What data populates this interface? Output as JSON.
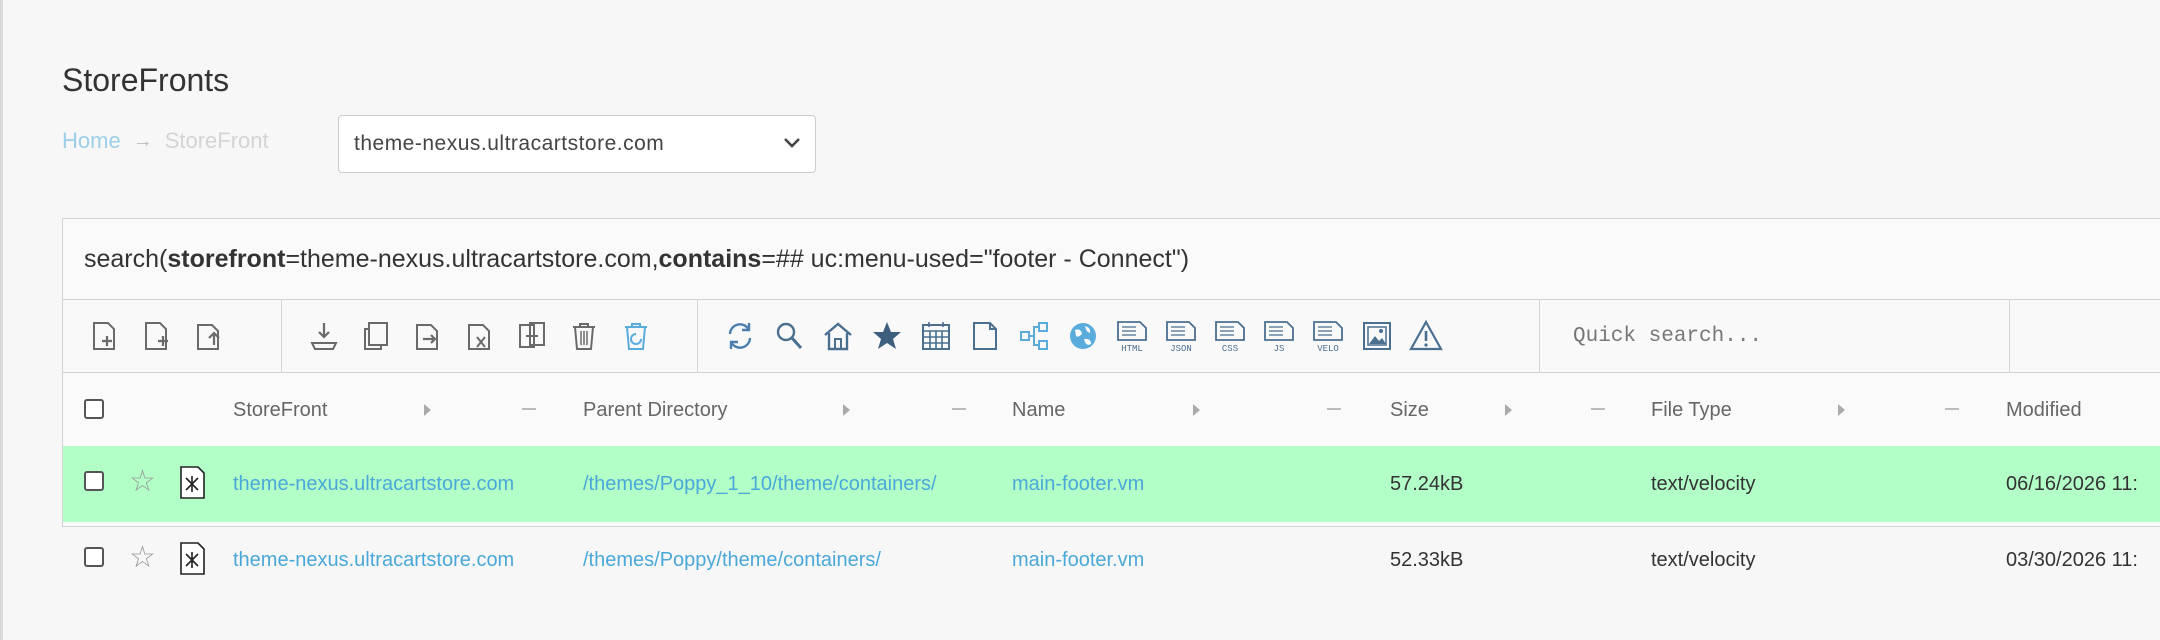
{
  "page": {
    "title": "StoreFronts"
  },
  "breadcrumb": {
    "home": "Home",
    "separator": "→",
    "current": "StoreFront"
  },
  "storefront_select": {
    "value": "theme-nexus.ultracartstore.com"
  },
  "search": {
    "prefix": "search(",
    "param1_key": "storefront",
    "param1_value": "=theme-nexus.ultracartstore.com, ",
    "param2_key": "contains",
    "param2_value": "=## uc:menu-used=\"footer - Connect\")"
  },
  "toolbar": {
    "group1": [
      "new-file-icon",
      "new-folder-icon",
      "upload-icon"
    ],
    "group2": [
      "download-icon",
      "copy-icon",
      "move-icon",
      "rename-icon",
      "compare-icon",
      "delete-icon",
      "restore-icon"
    ],
    "group3": [
      "refresh-icon",
      "search-icon",
      "home-icon",
      "favorite-icon",
      "calendar-icon",
      "folder-icon",
      "hierarchy-icon",
      "globe-icon",
      "html-icon",
      "json-icon",
      "css-icon",
      "js-icon",
      "velo-icon",
      "image-icon",
      "warning-icon"
    ],
    "file_type_labels": {
      "html": "HTML",
      "json": "JSON",
      "css": "CSS",
      "js": "JS",
      "velo": "VELO"
    },
    "quick_search_placeholder": "Quick search..."
  },
  "columns": [
    "StoreFront",
    "Parent Directory",
    "Name",
    "Size",
    "File Type",
    "Modified"
  ],
  "rows": [
    {
      "storefront": "theme-nexus.ultracartstore.com",
      "parent_directory": "/themes/Poppy_1_10/theme/containers/",
      "name": "main-footer.vm",
      "size": "57.24kB",
      "file_type": "text/velocity",
      "modified": "06/16/2026 11:",
      "highlighted": true
    },
    {
      "storefront": "theme-nexus.ultracartstore.com",
      "parent_directory": "/themes/Poppy/theme/containers/",
      "name": "main-footer.vm",
      "size": "52.33kB",
      "file_type": "text/velocity",
      "modified": "03/30/2026 11:",
      "highlighted": false
    }
  ],
  "colors": {
    "link": "#4aa8d8",
    "highlight_row": "#b3ffc8",
    "icon": "#4a6f8f",
    "icon_accent": "#5aacdc"
  }
}
